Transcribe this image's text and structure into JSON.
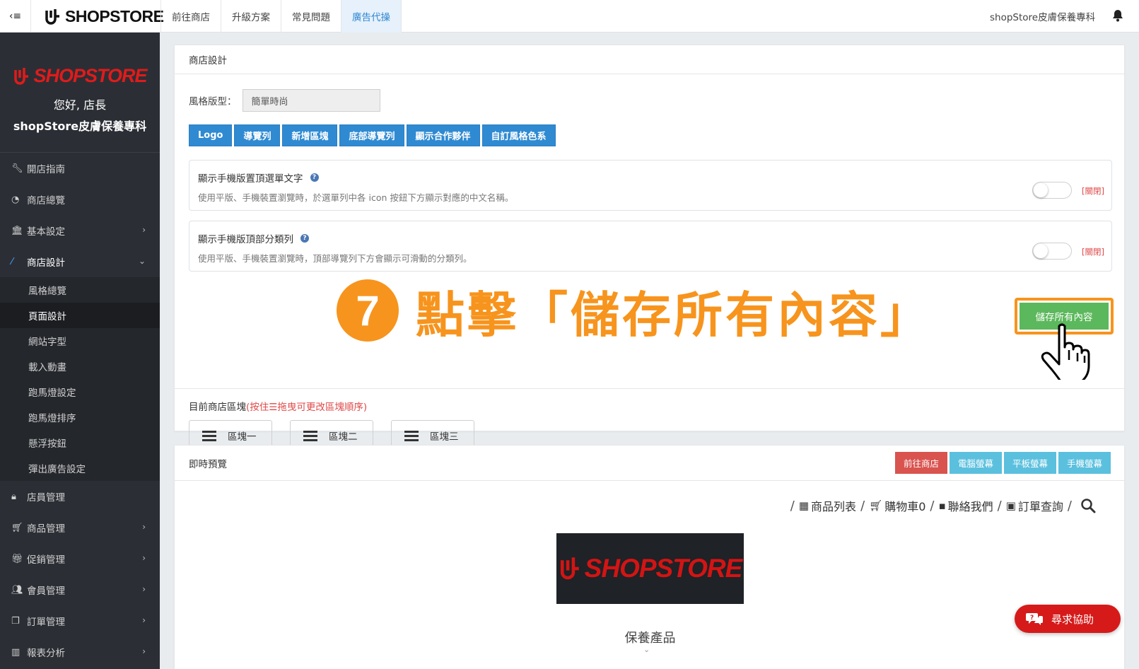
{
  "topbar": {
    "toggle_icon": "‹≡",
    "logo_text": "SHOPSTORE",
    "nav": [
      {
        "label": "前往商店"
      },
      {
        "label": "升級方案"
      },
      {
        "label": "常見問題"
      },
      {
        "label": "廣告代操",
        "active": true
      }
    ],
    "user_name": "shopStore皮膚保養專科"
  },
  "sidebar": {
    "logo_text": "SHOPSTORE",
    "greeting": "您好, 店長",
    "shop_name": "shopStore皮膚保養專科",
    "menu": [
      {
        "label": "開店指南",
        "icon": "wrench-icon"
      },
      {
        "label": "商店總覽",
        "icon": "dashboard-icon"
      },
      {
        "label": "基本設定",
        "icon": "bank-icon"
      },
      {
        "label": "商店設計",
        "icon": "magic-wand-icon"
      },
      {
        "label": "店員管理",
        "icon": "lock-icon"
      },
      {
        "label": "商品管理",
        "icon": "cart-icon"
      },
      {
        "label": "促銷管理",
        "icon": "gift-icon"
      },
      {
        "label": "會員管理",
        "icon": "users-icon"
      },
      {
        "label": "訂單管理",
        "icon": "copy-icon"
      },
      {
        "label": "報表分析",
        "icon": "chart-icon"
      }
    ],
    "submenu": [
      {
        "label": "風格總覽"
      },
      {
        "label": "頁面設計",
        "active": true
      },
      {
        "label": "網站字型"
      },
      {
        "label": "載入動畫"
      },
      {
        "label": "跑馬燈設定"
      },
      {
        "label": "跑馬燈排序"
      },
      {
        "label": "懸浮按鈕"
      },
      {
        "label": "彈出廣告設定"
      }
    ]
  },
  "design": {
    "title": "商店設計",
    "style_label": "風格版型：",
    "style_value": "簡單時尚",
    "buttons": [
      "Logo",
      "導覽列",
      "新增區塊",
      "底部導覽列",
      "顯示合作夥伴",
      "自訂風格色系"
    ],
    "options": [
      {
        "title": "顯示手機版置頂選單文字",
        "desc": "使用平版、手機裝置瀏覽時，於選單列中各 icon 按鈕下方顯示對應的中文名稱。",
        "state": "[關閉]"
      },
      {
        "title": "顯示手機版頂部分類列",
        "desc": "使用平版、手機裝置瀏覽時，頂部導覽列下方會顯示可滑動的分類列。",
        "state": "[關閉]"
      }
    ],
    "annotation_number": "7",
    "annotation_text": "點擊「儲存所有內容」",
    "save_label": "儲存所有內容",
    "blocks_label": "目前商店區塊",
    "blocks_hint": "(按住☰拖曳可更改區塊順序)",
    "blocks": [
      "區塊一",
      "區塊二",
      "區塊三"
    ]
  },
  "preview": {
    "title": "即時預覽",
    "buttons": [
      {
        "label": "前往商店",
        "color": "#d9534f"
      },
      {
        "label": "電腦螢幕",
        "color": "#5bc0de"
      },
      {
        "label": "平板螢幕",
        "color": "#5bc0de"
      },
      {
        "label": "手機螢幕",
        "color": "#5bc0de"
      }
    ],
    "site_nav": [
      {
        "label": "商品列表",
        "icon": "grid-icon"
      },
      {
        "label": "購物車0",
        "icon": "cart-icon"
      },
      {
        "label": "聯絡我們",
        "icon": "chat-icon"
      },
      {
        "label": "訂單查詢",
        "icon": "clipboard-icon"
      }
    ],
    "site_logo_text": "SHOPSTORE",
    "category": "保養產品"
  },
  "help": {
    "label": "尋求協助"
  }
}
